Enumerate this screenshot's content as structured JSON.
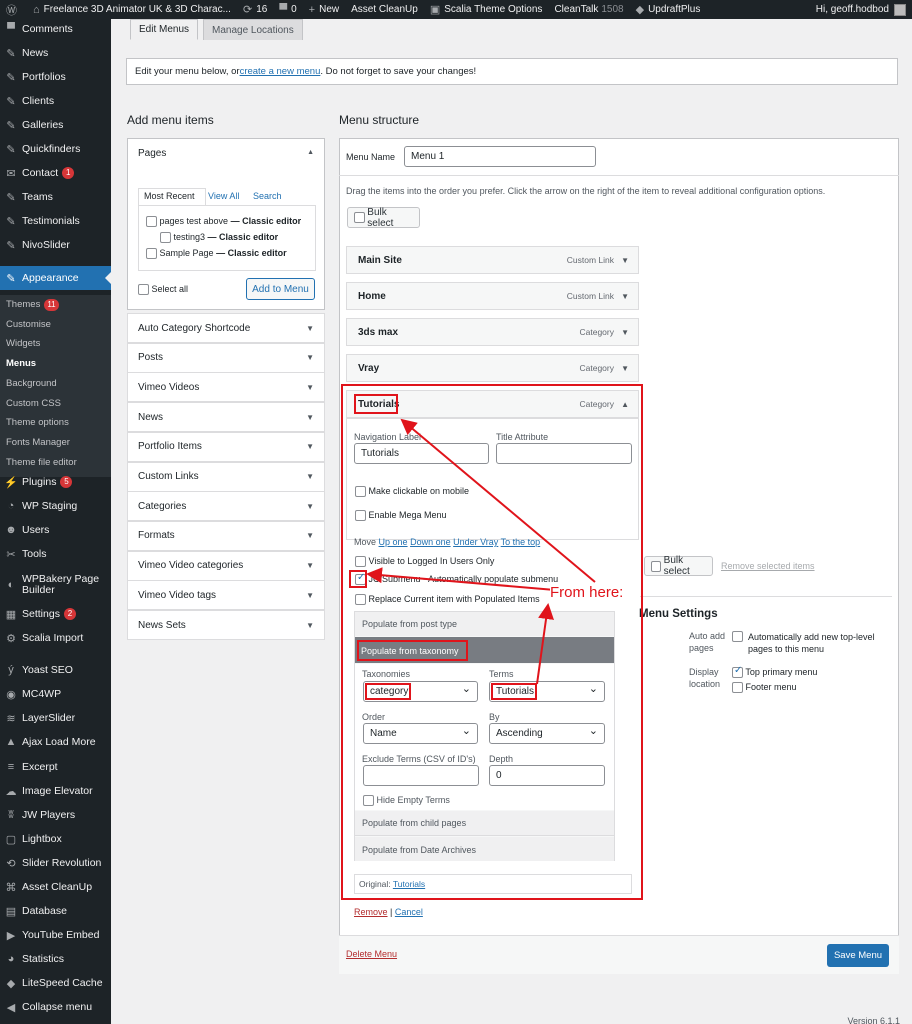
{
  "adminbar": {
    "site_title": "Freelance 3D Animator UK & 3D Charac...",
    "updates_count": "16",
    "comments_count": "0",
    "new_label": "New",
    "asset_cleanup": "Asset CleanUp",
    "scalia_options": "Scalia Theme Options",
    "cleantalk": "CleanTalk",
    "cleantalk_count": "1508",
    "updraft": "UpdraftPlus",
    "greeting": "Hi, geoff.hodbod"
  },
  "sidebar": {
    "top_items": [
      {
        "label": "Comments",
        "icon": "comment-icon"
      },
      {
        "label": "News",
        "icon": "pin-icon"
      },
      {
        "label": "Portfolios",
        "icon": "pin-icon"
      },
      {
        "label": "Clients",
        "icon": "pin-icon"
      },
      {
        "label": "Galleries",
        "icon": "pin-icon"
      },
      {
        "label": "Quickfinders",
        "icon": "pin-icon"
      },
      {
        "label": "Contact",
        "icon": "mail-icon",
        "badge": "1"
      },
      {
        "label": "Teams",
        "icon": "pin-icon"
      },
      {
        "label": "Testimonials",
        "icon": "pin-icon"
      },
      {
        "label": "NivoSlider",
        "icon": "pin-icon"
      }
    ],
    "appearance": "Appearance",
    "submenu": [
      {
        "label": "Themes",
        "badge": "11"
      },
      {
        "label": "Customise"
      },
      {
        "label": "Widgets"
      },
      {
        "label": "Menus",
        "current": true
      },
      {
        "label": "Background"
      },
      {
        "label": "Custom CSS"
      },
      {
        "label": "Theme options"
      },
      {
        "label": "Fonts Manager"
      },
      {
        "label": "Theme file editor"
      }
    ],
    "bottom_items": [
      {
        "label": "Plugins",
        "icon": "plugin-icon",
        "badge": "5"
      },
      {
        "label": "WP Staging",
        "icon": "staging-icon"
      },
      {
        "label": "Users",
        "icon": "users-icon"
      },
      {
        "label": "Tools",
        "icon": "tools-icon"
      },
      {
        "label": "WPBakery Page Builder",
        "icon": "wpbakery-icon"
      },
      {
        "label": "Settings",
        "icon": "settings-icon",
        "badge": "2"
      },
      {
        "label": "Scalia Import",
        "icon": "import-icon"
      },
      {
        "label": "Yoast SEO",
        "icon": "yoast-icon"
      },
      {
        "label": "MC4WP",
        "icon": "mc4wp-icon"
      },
      {
        "label": "LayerSlider",
        "icon": "layers-icon"
      },
      {
        "label": "Ajax Load More",
        "icon": "ajax-icon"
      },
      {
        "label": "Excerpt",
        "icon": "excerpt-icon"
      },
      {
        "label": "Image Elevator",
        "icon": "elevator-icon"
      },
      {
        "label": "JW Players",
        "icon": "jw-icon"
      },
      {
        "label": "Lightbox",
        "icon": "lightbox-icon"
      },
      {
        "label": "Slider Revolution",
        "icon": "revolution-icon"
      },
      {
        "label": "Asset CleanUp",
        "icon": "cleanup-icon"
      },
      {
        "label": "Database",
        "icon": "database-icon"
      },
      {
        "label": "YouTube Embed",
        "icon": "youtube-icon"
      },
      {
        "label": "Statistics",
        "icon": "statistics-icon"
      },
      {
        "label": "LiteSpeed Cache",
        "icon": "litespeed-icon"
      },
      {
        "label": "Collapse menu",
        "icon": "collapse-icon"
      }
    ]
  },
  "tabs": {
    "edit": "Edit Menus",
    "manage": "Manage Locations"
  },
  "notice": {
    "before": "Edit your menu below, or ",
    "link": "create a new menu",
    "after": ". Do not forget to save your changes!"
  },
  "add_items": {
    "title": "Add menu items",
    "pages_title": "Pages",
    "pages_tabs": [
      "Most Recent",
      "View All",
      "Search"
    ],
    "pages": [
      {
        "label": "pages test above",
        "suffix": " — Classic editor"
      },
      {
        "label": "testing3",
        "suffix": " — Classic editor"
      },
      {
        "label": "Sample Page",
        "suffix": " — Classic editor"
      }
    ],
    "select_all": "Select all",
    "add_button": "Add to Menu",
    "sections": [
      "Auto Category Shortcode",
      "Posts",
      "Vimeo Videos",
      "News",
      "Portfolio Items",
      "Custom Links",
      "Categories",
      "Formats",
      "Vimeo Video categories",
      "Vimeo Video tags",
      "News Sets"
    ]
  },
  "structure": {
    "title": "Menu structure",
    "menu_name_label": "Menu Name",
    "menu_name_value": "Menu 1",
    "instructions": "Drag the items into the order you prefer. Click the arrow on the right of the item to reveal additional configuration options.",
    "bulk_select": "Bulk select",
    "items": [
      {
        "label": "Main Site",
        "type": "Custom Link"
      },
      {
        "label": "Home",
        "type": "Custom Link"
      },
      {
        "label": "3ds max",
        "type": "Category"
      },
      {
        "label": "Vray",
        "type": "Category"
      }
    ],
    "open_item": {
      "label": "Tutorials",
      "type": "Category",
      "nav_label_title": "Navigation Label",
      "nav_label_value": "Tutorials",
      "title_attr": "Title Attribute",
      "clickable_mobile": "Make clickable on mobile",
      "mega_menu": "Enable Mega Menu",
      "move_label": "Move",
      "move_links": [
        "Up one",
        "Down one",
        "Under Vray",
        "To the top"
      ],
      "visible_logged": "Visible to Logged In Users Only",
      "jc_submenu_a": "JC Submenu",
      "jc_submenu_b": " - Automatically populate submenu",
      "replace_current": "Replace Current item with Populated Items",
      "populate_post_type": "Populate from post type",
      "populate_taxonomy": "Populate from taxonomy",
      "taxonomies_label": "Taxonomies",
      "taxonomies_value": "category",
      "terms_label": "Terms",
      "terms_value": "Tutorials",
      "order_label": "Order",
      "order_value": "Name",
      "by_label": "By",
      "by_value": "Ascending",
      "exclude_label": "Exclude Terms (CSV of ID's)",
      "depth_label": "Depth",
      "depth_value": "0",
      "hide_empty": "Hide Empty Terms",
      "populate_child": "Populate from child pages",
      "populate_date": "Populate from Date Archives",
      "original_label": "Original:",
      "original_link": "Tutorials",
      "remove": "Remove",
      "cancel": "Cancel"
    },
    "bulk_select_2": "Bulk select",
    "remove_selected": "Remove selected items",
    "menu_settings_title": "Menu Settings",
    "auto_add_label": "Auto add pages",
    "auto_add_text": "Automatically add new top-level pages to this menu",
    "display_location_label": "Display location",
    "locations": [
      {
        "label": "Top primary menu",
        "checked": true
      },
      {
        "label": "Footer menu",
        "checked": false
      }
    ],
    "delete_menu": "Delete Menu",
    "save_menu": "Save Menu"
  },
  "annotation": {
    "text": "From here:",
    "color": "#e0141b"
  },
  "footer": {
    "version": "Version 6.1.1"
  },
  "colors": {
    "admin_bar": "#1d2327",
    "accent": "#2271b1",
    "badge": "#d63638",
    "annotation": "#e0141b"
  }
}
